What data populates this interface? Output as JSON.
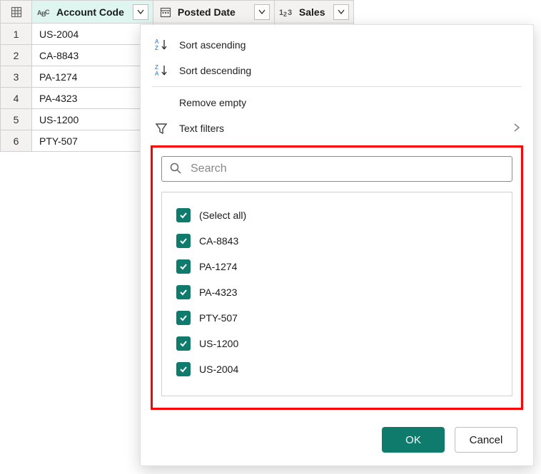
{
  "columns": {
    "account_code": "Account Code",
    "posted_date": "Posted Date",
    "sales": "Sales"
  },
  "rows": [
    {
      "n": "1",
      "code": "US-2004"
    },
    {
      "n": "2",
      "code": "CA-8843"
    },
    {
      "n": "3",
      "code": "PA-1274"
    },
    {
      "n": "4",
      "code": "PA-4323"
    },
    {
      "n": "5",
      "code": "US-1200"
    },
    {
      "n": "6",
      "code": "PTY-507"
    }
  ],
  "menu": {
    "sort_asc": "Sort ascending",
    "sort_desc": "Sort descending",
    "remove_empty": "Remove empty",
    "text_filters": "Text filters"
  },
  "search": {
    "placeholder": "Search"
  },
  "values": [
    "(Select all)",
    "CA-8843",
    "PA-1274",
    "PA-4323",
    "PTY-507",
    "US-1200",
    "US-2004"
  ],
  "buttons": {
    "ok": "OK",
    "cancel": "Cancel"
  }
}
